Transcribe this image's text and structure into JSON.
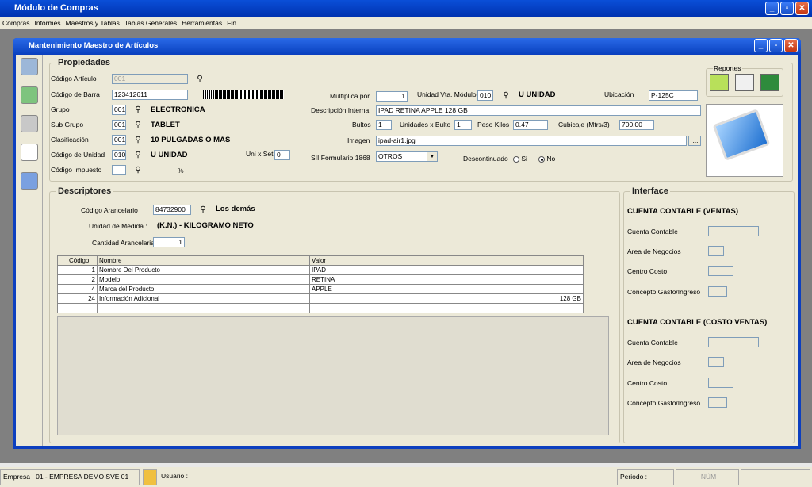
{
  "window": {
    "title": "Módulo de Compras"
  },
  "menu": [
    "Compras",
    "Informes",
    "Maestros y Tablas",
    "Tablas Generales",
    "Herramientas",
    "Fin"
  ],
  "dialog": {
    "title": "Mantenimiento Maestro de Artículos"
  },
  "propiedades": {
    "title": "Propiedades",
    "codigo_articulo": {
      "label": "Código Artículo",
      "value": "001"
    },
    "codigo_barra": {
      "label": "Código de Barra",
      "value": "123412611"
    },
    "grupo": {
      "label": "Grupo",
      "code": "001",
      "name": "ELECTRONICA"
    },
    "subgrupo": {
      "label": "Sub Grupo",
      "code": "001",
      "name": "TABLET"
    },
    "clasificacion": {
      "label": "Clasificación",
      "code": "001",
      "name": "10 PULGADAS O MAS"
    },
    "codigo_unidad": {
      "label": "Código de Unidad",
      "code": "010",
      "name": "U  UNIDAD"
    },
    "uni_set": {
      "label": "Uni x Set",
      "value": "0"
    },
    "codigo_impuesto": {
      "label": "Código Impuesto",
      "value": "",
      "pct": "%"
    },
    "multiplica": {
      "label": "Multiplica por",
      "value": "1"
    },
    "unidad_vta": {
      "label": "Unidad Vta. Módulo",
      "code": "010",
      "name": "U  UNIDAD"
    },
    "ubicacion": {
      "label": "Ubicación",
      "value": "P-125C"
    },
    "desc_interna": {
      "label": "Descripción Interna",
      "value": "IPAD RETINA APPLE 128 GB"
    },
    "bultos": {
      "label": "Bultos",
      "value": "1"
    },
    "unid_bulto": {
      "label": "Unidades x Bulto",
      "value": "1"
    },
    "peso": {
      "label": "Peso Kilos",
      "value": "0.47"
    },
    "cubicaje": {
      "label": "Cubicaje  (Mtrs/3)",
      "value": "700.00"
    },
    "imagen": {
      "label": "Imagen",
      "value": "ipad-air1.jpg",
      "btn": "..."
    },
    "sii": {
      "label": "SII Formulario 1868",
      "value": "OTROS"
    },
    "descontinuado": {
      "label": "Descontinuado",
      "si": "Si",
      "no": "No"
    },
    "reportes": "Reportes"
  },
  "descriptores": {
    "title": "Descriptores",
    "arancelario": {
      "label": "Código Arancelario",
      "value": "84732900",
      "name": "Los demás"
    },
    "unidad_medida": {
      "label": "Unidad de Medida :",
      "value": "(K.N.) - KILOGRAMO NETO"
    },
    "cantidad": {
      "label": "Cantidad Arancelaria:",
      "value": "1"
    },
    "columns": [
      "Código",
      "Nombre",
      "Valor"
    ],
    "rows": [
      {
        "codigo": "1",
        "nombre": "Nombre Del Producto",
        "valor": "IPAD"
      },
      {
        "codigo": "2",
        "nombre": "Modelo",
        "valor": "RETINA"
      },
      {
        "codigo": "4",
        "nombre": "Marca del Producto",
        "valor": "APPLE"
      },
      {
        "codigo": "24",
        "nombre": "Información Adicional",
        "valor": "128 GB"
      }
    ]
  },
  "interface": {
    "title": "Interface",
    "ventas_title": "CUENTA CONTABLE (VENTAS)",
    "costo_title": "CUENTA CONTABLE (COSTO VENTAS)",
    "fields": [
      "Cuenta Contable",
      "Area de Negocios",
      "Centro Costo",
      "Concepto Gasto/Ingreso"
    ]
  },
  "status": {
    "empresa": "Empresa : 01 - EMPRESA DEMO SVE 01",
    "usuario": "Usuario :",
    "periodo": "Periodo :",
    "num": "NÚM"
  }
}
